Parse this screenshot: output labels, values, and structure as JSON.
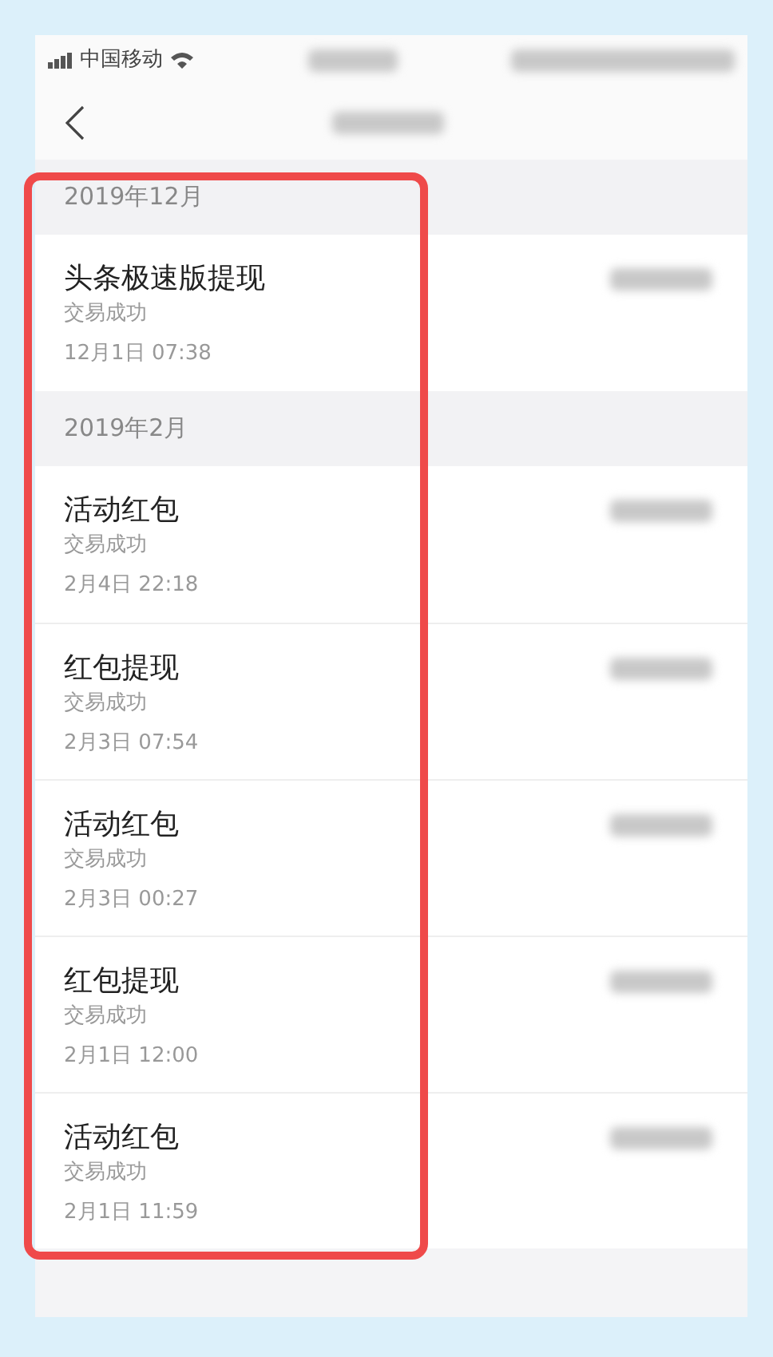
{
  "status_bar": {
    "carrier": "中国移动"
  },
  "groups": [
    {
      "header": "2019年12月",
      "records": [
        {
          "title": "头条极速版提现",
          "status": "交易成功",
          "time": "12月1日 07:38"
        }
      ]
    },
    {
      "header": "2019年2月",
      "records": [
        {
          "title": "活动红包",
          "status": "交易成功",
          "time": "2月4日 22:18"
        },
        {
          "title": "红包提现",
          "status": "交易成功",
          "time": "2月3日 07:54"
        },
        {
          "title": "活动红包",
          "status": "交易成功",
          "time": "2月3日 00:27"
        },
        {
          "title": "红包提现",
          "status": "交易成功",
          "time": "2月1日 12:00"
        },
        {
          "title": "活动红包",
          "status": "交易成功",
          "time": "2月1日 11:59"
        }
      ]
    }
  ]
}
